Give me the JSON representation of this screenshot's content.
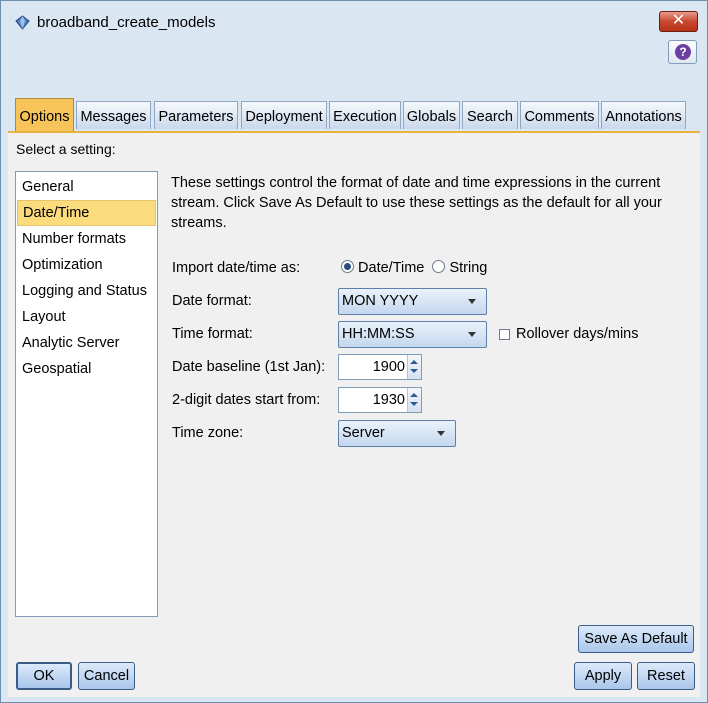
{
  "window": {
    "title": "broadband_create_models",
    "close_glyph": "✕",
    "help_glyph": "?"
  },
  "tabs": [
    {
      "label": "Options",
      "active": true
    },
    {
      "label": "Messages"
    },
    {
      "label": "Parameters"
    },
    {
      "label": "Deployment"
    },
    {
      "label": "Execution"
    },
    {
      "label": "Globals"
    },
    {
      "label": "Search"
    },
    {
      "label": "Comments"
    },
    {
      "label": "Annotations"
    }
  ],
  "settings": {
    "prompt": "Select a setting:",
    "items": [
      {
        "label": "General"
      },
      {
        "label": "Date/Time",
        "selected": true
      },
      {
        "label": "Number formats"
      },
      {
        "label": "Optimization"
      },
      {
        "label": "Logging and Status"
      },
      {
        "label": "Layout"
      },
      {
        "label": "Analytic Server"
      },
      {
        "label": "Geospatial"
      }
    ]
  },
  "datetime": {
    "description": "These settings control the format of date and time expressions in the current stream. Click Save As Default to use these settings as the default for all your streams.",
    "import_label": "Import date/time as:",
    "import_options": [
      "Date/Time",
      "String"
    ],
    "import_selected": "Date/Time",
    "date_format_label": "Date format:",
    "date_format_value": "MON YYYY",
    "time_format_label": "Time format:",
    "time_format_value": "HH:MM:SS",
    "rollover_label": "Rollover days/mins",
    "rollover_checked": false,
    "baseline_label": "Date baseline (1st Jan):",
    "baseline_value": "1900",
    "twodigit_label": "2-digit dates start from:",
    "twodigit_value": "1930",
    "timezone_label": "Time zone:",
    "timezone_value": "Server"
  },
  "buttons": {
    "save_default": "Save As Default",
    "ok": "OK",
    "cancel": "Cancel",
    "apply": "Apply",
    "reset": "Reset"
  },
  "colors": {
    "active_tab": "#f7c45a",
    "selected_item": "#fbdc7d",
    "window_frame": "#dbe6f3"
  }
}
